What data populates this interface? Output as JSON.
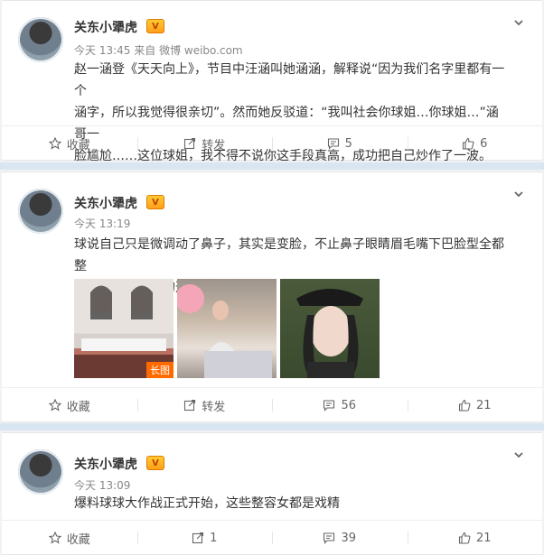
{
  "posts": [
    {
      "author": "关东小犟虎",
      "vip_badge": "V",
      "time": "今天 13:45",
      "source_prefix": "来自",
      "source": "微博 weibo.com",
      "text": "赵一涵登《天天向上》，节目中汪涵叫她涵涵，解释说“因为我们名字里都有一个\n涵字，所以我觉得很亲切”。然而她反驳道：“我叫社会你球姐…你球姐…”涵哥一\n脸尴尬……这位球姐，我不得不说你这手段真高，成功把自己炒作了一波。",
      "actions": {
        "fav": "收藏",
        "repost": "转发",
        "comment": "5",
        "like": "6"
      }
    },
    {
      "author": "关东小犟虎",
      "vip_badge": "V",
      "time": "今天 13:19",
      "text": "球说自己只是微调动了鼻子，其实是变脸，不止鼻子眼睛眉毛嘴下巴脸型全都整\n了，所以才能垮的这么快",
      "image_tag": "长图",
      "actions": {
        "fav": "收藏",
        "repost": "转发",
        "comment": "56",
        "like": "21"
      }
    },
    {
      "author": "关东小犟虎",
      "vip_badge": "V",
      "time": "今天 13:09",
      "text": "爆料球球大作战正式开始，这些整容女都是戏精",
      "actions": {
        "fav": "收藏",
        "repost": "1",
        "comment": "39",
        "like": "21"
      }
    }
  ],
  "colors": {
    "band": "#d9e6f2",
    "badge": "#ffb31a",
    "text": "#333333",
    "meta": "#888888"
  },
  "icons": [
    "star-icon",
    "repost-icon",
    "comment-icon",
    "like-icon",
    "chevron-down-icon"
  ]
}
